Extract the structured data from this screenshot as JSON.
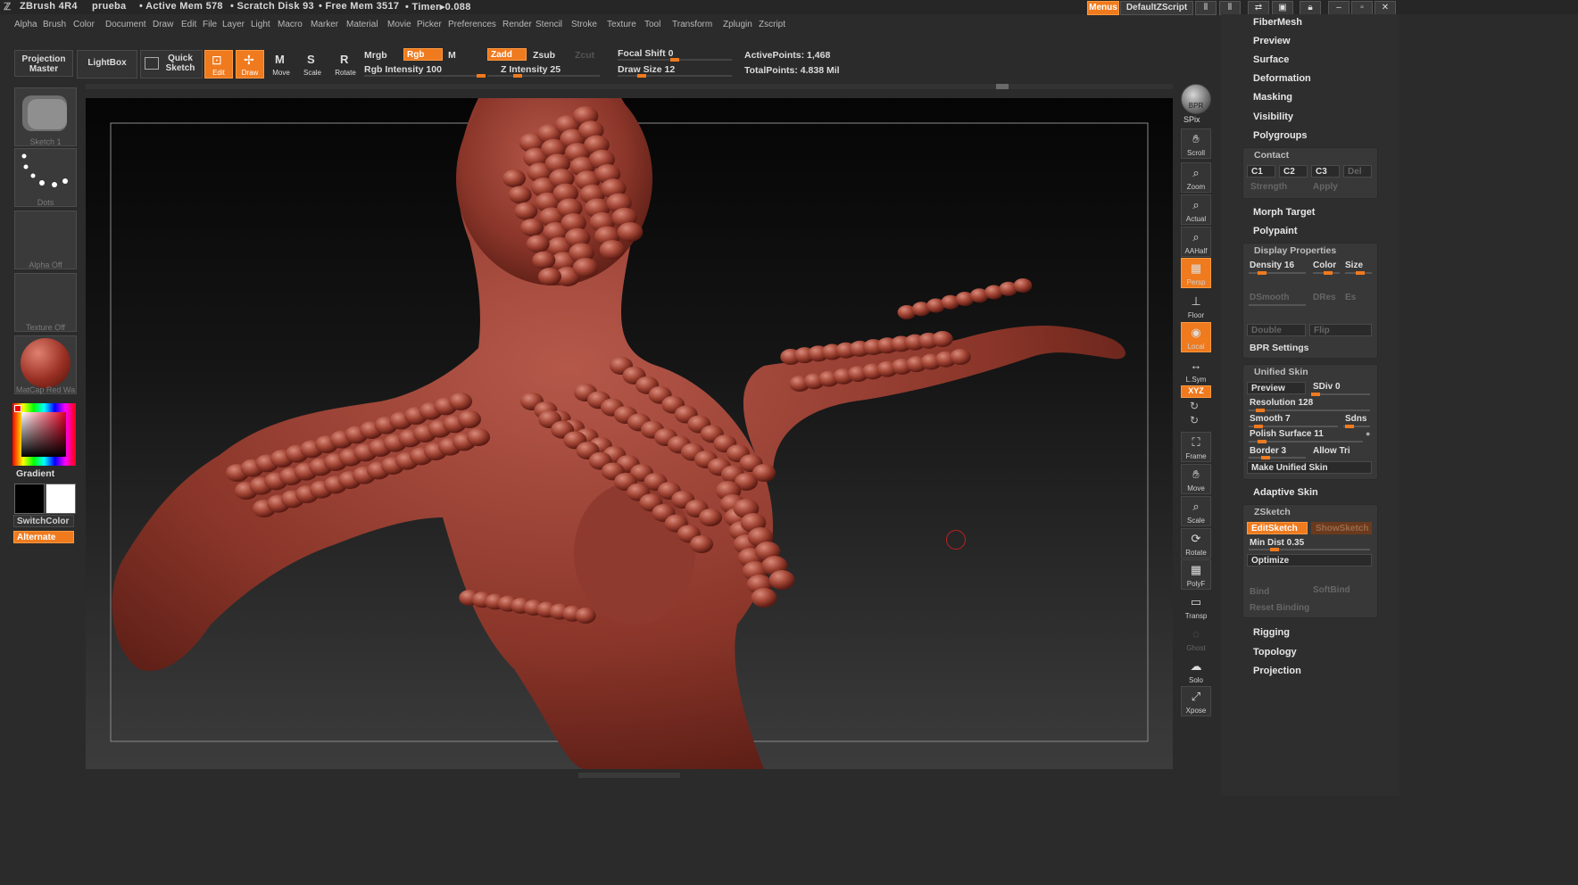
{
  "title": {
    "app": "ZBrush 4R4",
    "doc": "prueba",
    "active_mem": "• Active Mem 578",
    "scratch_disk": "• Scratch Disk 93",
    "free_mem": "• Free Mem 3517",
    "timer": "• Timer▸0.088",
    "menus_btn": "Menus",
    "script_btn": "DefaultZScript"
  },
  "menu": [
    "Alpha",
    "Brush",
    "Color",
    "Document",
    "Draw",
    "Edit",
    "File",
    "Layer",
    "Light",
    "Macro",
    "Marker",
    "Material",
    "Movie",
    "Picker",
    "Preferences",
    "Render",
    "Stencil",
    "Stroke",
    "Texture",
    "Tool",
    "Transform",
    "Zplugin",
    "Zscript"
  ],
  "toolbar": {
    "projection_master": "Projection Master",
    "lightbox": "LightBox",
    "quick_sketch": "Quick Sketch",
    "edit": "Edit",
    "draw": "Draw",
    "move": "Move",
    "scale": "Scale",
    "rotate": "Rotate",
    "mrgb": "Mrgb",
    "rgb": "Rgb",
    "m": "M",
    "rgb_intensity": "Rgb Intensity 100",
    "zadd": "Zadd",
    "zsub": "Zsub",
    "zcut": "Zcut",
    "z_intensity": "Z Intensity 25",
    "focal_shift": "Focal Shift 0",
    "draw_size": "Draw Size 12",
    "active_points": "ActivePoints: 1,468",
    "total_points": "TotalPoints: 4.838 Mil",
    "rgb_intensity_value": 100,
    "z_intensity_value": 25,
    "focal_shift_value": 0,
    "draw_size_value": 12
  },
  "left": {
    "sketch": "Sketch 1",
    "dots": "Dots",
    "alpha": "Alpha Off",
    "texture": "Texture Off",
    "matcap": "MatCap Red Wa",
    "gradient": "Gradient",
    "switch_color": "SwitchColor",
    "alternate": "Alternate"
  },
  "right_shelf": [
    "SPix",
    "Scroll",
    "Zoom",
    "Actual",
    "AAHalf",
    "Persp",
    "Floor",
    "Local",
    "L.Sym",
    "XYZ",
    "Frame",
    "Move",
    "Scale",
    "Rotate",
    "PolyF",
    "Transp",
    "Ghost",
    "Solo",
    "Xpose"
  ],
  "right_shelf_top": "BPR",
  "tray": {
    "fibermesh": "FiberMesh",
    "preview": "Preview",
    "surface": "Surface",
    "deformation": "Deformation",
    "masking": "Masking",
    "visibility": "Visibility",
    "polygroups": "Polygroups",
    "contact": {
      "title": "Contact",
      "c1": "C1",
      "c2": "C2",
      "c3": "C3",
      "del": "Del",
      "strength": "Strength",
      "apply": "Apply"
    },
    "morph_target": "Morph Target",
    "polypaint": "Polypaint",
    "display": {
      "title": "Display Properties",
      "density": "Density 16",
      "color": "Color",
      "size": "Size",
      "dsmooth": "DSmooth",
      "dres": "DRes",
      "es": "Es",
      "double": "Double",
      "flip": "Flip",
      "bpr": "BPR Settings"
    },
    "unified": {
      "title": "Unified Skin",
      "preview": "Preview",
      "sdiv": "SDiv 0",
      "resolution": "Resolution 128",
      "smooth": "Smooth 7",
      "sdns": "Sdns",
      "polish": "Polish Surface 11",
      "border": "Border 3",
      "allow_tri": "Allow Tri",
      "make": "Make Unified Skin"
    },
    "adaptive_skin": "Adaptive Skin",
    "zsketch": {
      "title": "ZSketch",
      "edit": "EditSketch",
      "show": "ShowSketch",
      "min_dist": "Min Dist 0.35",
      "optimize": "Optimize",
      "bind": "Bind",
      "softbind": "SoftBind",
      "reset": "Reset Binding"
    },
    "rigging": "Rigging",
    "topology": "Topology",
    "projection": "Projection"
  },
  "colors": {
    "accent": "#f07a1e",
    "model": "#8e3a2c",
    "background": "#2b2b2b"
  }
}
